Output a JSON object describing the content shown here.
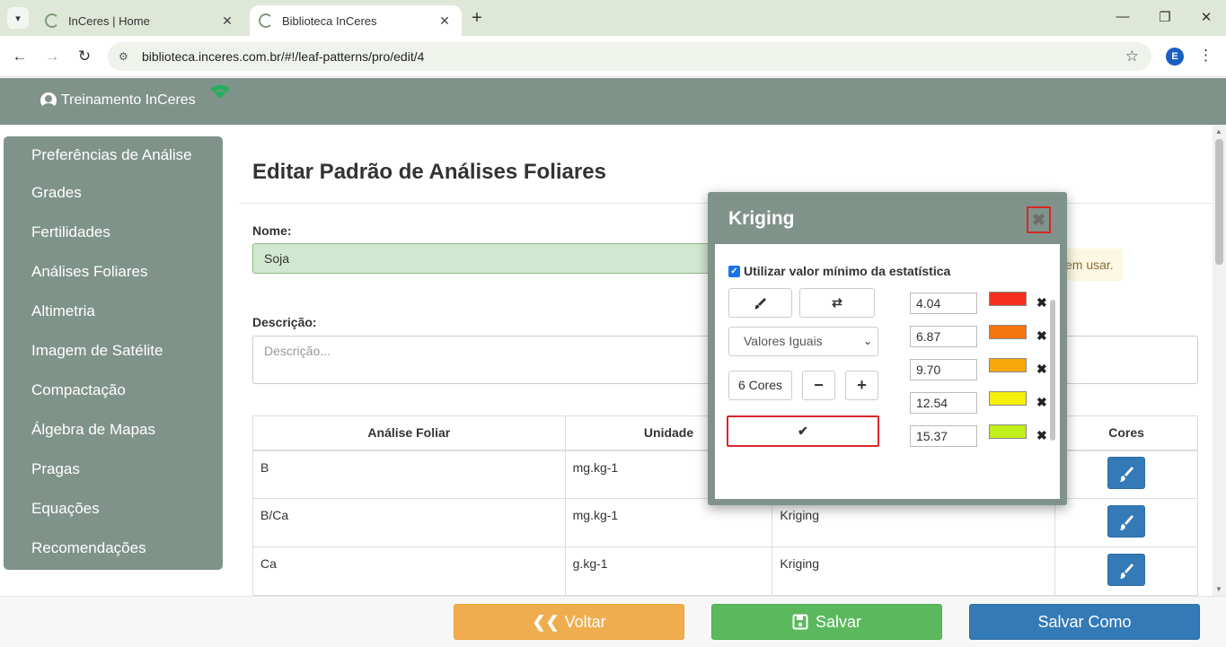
{
  "browser": {
    "tabs": [
      {
        "title": "InCeres | Home",
        "active": false
      },
      {
        "title": "Biblioteca InCeres",
        "active": true
      }
    ],
    "url": "biblioteca.inceres.com.br/#!/leaf-patterns/pro/edit/4",
    "profile_initial": "E"
  },
  "header": {
    "user_name": "Treinamento InCeres",
    "online_color": "#27ae60"
  },
  "sidebar": {
    "items": [
      {
        "label": "Preferências de Análise"
      },
      {
        "label": "Grades"
      },
      {
        "label": "Fertilidades"
      },
      {
        "label": "Análises Foliares"
      },
      {
        "label": "Altimetria"
      },
      {
        "label": "Imagem de Satélite"
      },
      {
        "label": "Compactação"
      },
      {
        "label": "Álgebra de Mapas"
      },
      {
        "label": "Pragas"
      },
      {
        "label": "Equações"
      },
      {
        "label": "Recomendações"
      }
    ]
  },
  "main": {
    "title": "Editar Padrão de Análises Foliares",
    "name_label": "Nome:",
    "name_value": "Soja",
    "hint_text": "em usar.",
    "description_label": "Descrição:",
    "description_placeholder": "Descrição...",
    "table": {
      "headers": [
        "Análise Foliar",
        "Unidade",
        "",
        "Cores"
      ],
      "rows": [
        {
          "analysis": "B",
          "unit": "mg.kg-1",
          "method": ""
        },
        {
          "analysis": "B/Ca",
          "unit": "mg.kg-1",
          "method": "Kriging"
        },
        {
          "analysis": "Ca",
          "unit": "g.kg-1",
          "method": "Kriging"
        }
      ]
    }
  },
  "footer": {
    "back_label": "Voltar",
    "save_label": "Salvar",
    "save_as_label": "Salvar Como"
  },
  "modal": {
    "title": "Kriging",
    "use_min_label": "Utilizar valor mínimo da estatística",
    "use_min_checked": true,
    "interval_select": "Valores Iguais",
    "color_count": "6 Cores",
    "breaks": [
      {
        "value": "4.04",
        "color": "#f52e1e"
      },
      {
        "value": "6.87",
        "color": "#f5760c"
      },
      {
        "value": "9.70",
        "color": "#f7a80c"
      },
      {
        "value": "12.54",
        "color": "#f5ef0c"
      },
      {
        "value": "15.37",
        "color": "#c1ef1a"
      }
    ]
  }
}
